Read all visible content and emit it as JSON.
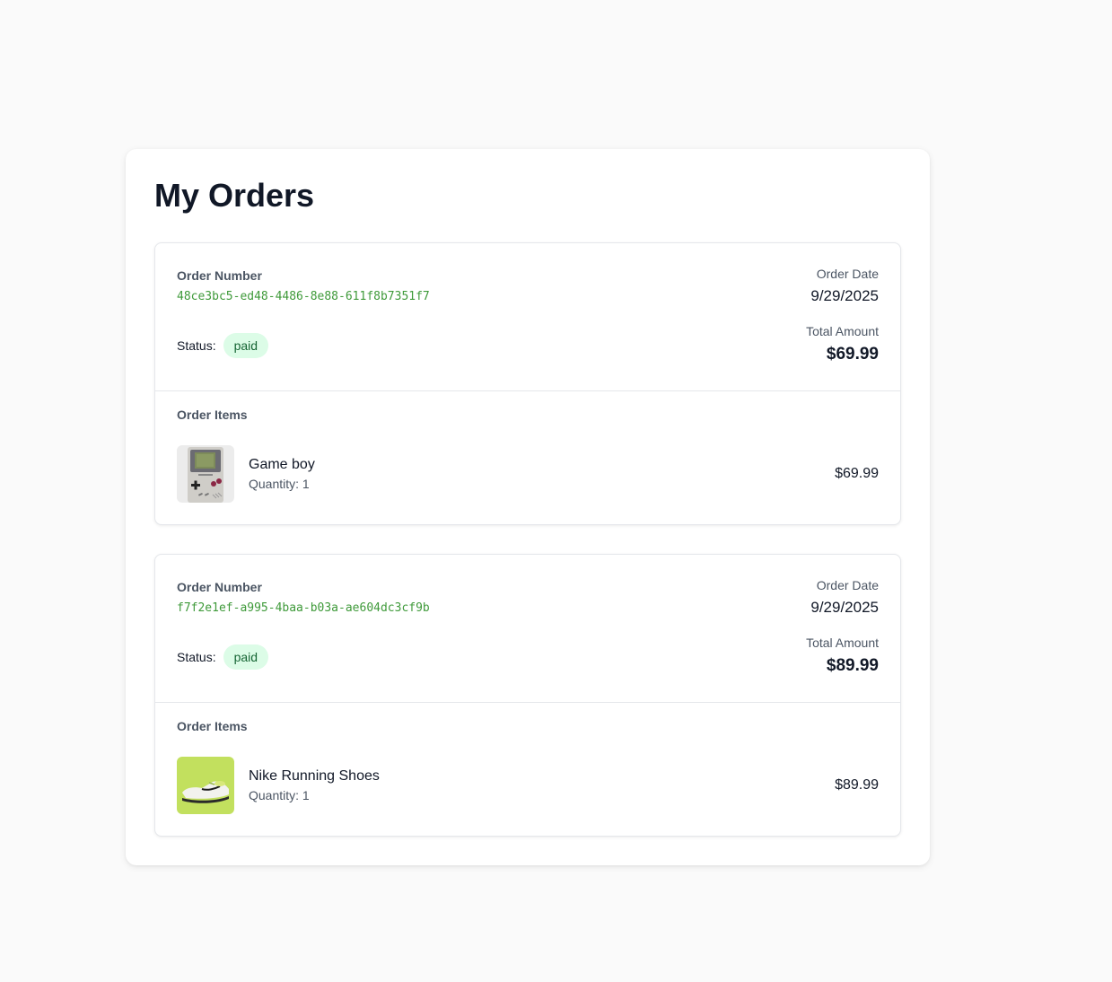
{
  "page": {
    "title": "My Orders"
  },
  "labels": {
    "order_number": "Order Number",
    "status": "Status:",
    "order_date": "Order Date",
    "total_amount": "Total Amount",
    "order_items": "Order Items",
    "quantity_prefix": "Quantity:"
  },
  "orders": [
    {
      "order_number": "48ce3bc5-ed48-4486-8e88-611f8b7351f7",
      "status": "paid",
      "order_date": "9/29/2025",
      "total": "$69.99",
      "items": [
        {
          "name": "Game boy",
          "quantity": "Quantity: 1",
          "price": "$69.99",
          "image_icon": "gameboy-image"
        }
      ]
    },
    {
      "order_number": "f7f2e1ef-a995-4baa-b03a-ae604dc3cf9b",
      "status": "paid",
      "order_date": "9/29/2025",
      "total": "$89.99",
      "items": [
        {
          "name": "Nike Running Shoes",
          "quantity": "Quantity: 1",
          "price": "$89.99",
          "image_icon": "shoe-image"
        }
      ]
    }
  ],
  "colors": {
    "order_number": "#3f9a3a",
    "status_badge_bg": "#dcfce7",
    "status_badge_text": "#166534",
    "shoe_bg": "#c2e05e"
  }
}
